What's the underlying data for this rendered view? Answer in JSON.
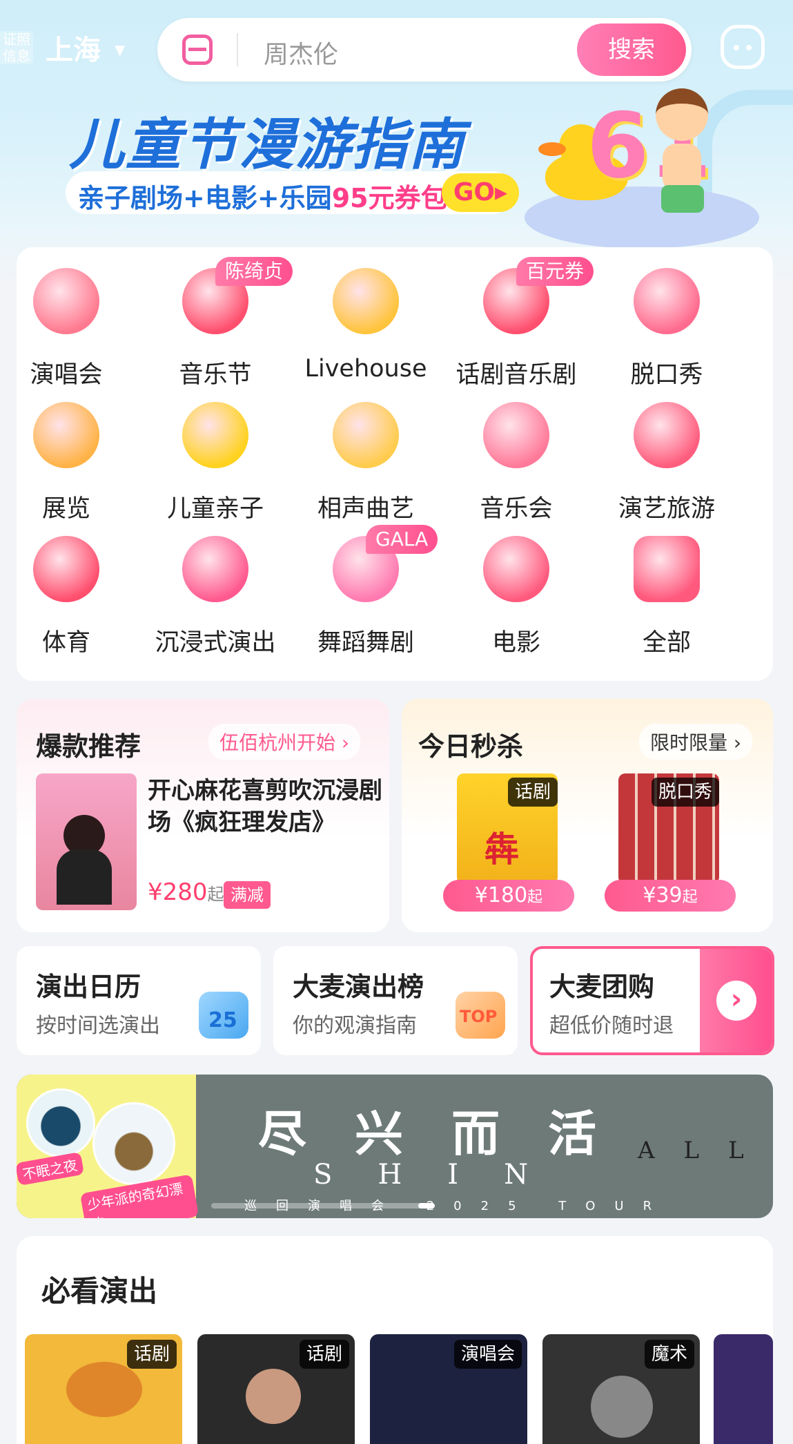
{
  "header": {
    "license_line1": "证照",
    "license_line2": "信息",
    "city": "上海",
    "search_placeholder": "周杰伦",
    "search_button": "搜索"
  },
  "banner": {
    "title": "儿童节漫游指南",
    "subtitle_prefix": "亲子剧场+电影+乐园",
    "subtitle_highlight": "95元券包",
    "go": "GO",
    "badge_number": "61"
  },
  "categories": [
    {
      "label": "演唱会",
      "icon": "microphone-icon",
      "color": "#ff7a90"
    },
    {
      "label": "音乐节",
      "icon": "music-note-icon",
      "color": "#ff4f6e",
      "badge": "陈绮贞"
    },
    {
      "label": "Livehouse",
      "icon": "guitar-icon",
      "color": "#ffc43d"
    },
    {
      "label": "话剧音乐剧",
      "icon": "theater-icon",
      "color": "#ff4f6e",
      "badge": "百元券"
    },
    {
      "label": "脱口秀",
      "icon": "lips-icon",
      "color": "#ff6b8e"
    },
    {
      "label": "展览",
      "icon": "picture-frame-icon",
      "color": "#ffb347"
    },
    {
      "label": "儿童亲子",
      "icon": "duck-icon",
      "color": "#ffd21f"
    },
    {
      "label": "相声曲艺",
      "icon": "fan-icon",
      "color": "#ffcc4d"
    },
    {
      "label": "音乐会",
      "icon": "piano-icon",
      "color": "#ff7a9a"
    },
    {
      "label": "演艺旅游",
      "icon": "palm-tree-icon",
      "color": "#ff5d7e"
    },
    {
      "label": "体育",
      "icon": "football-icon",
      "color": "#ff4f6e"
    },
    {
      "label": "沉浸式演出",
      "icon": "vr-headset-icon",
      "color": "#ff5a8f"
    },
    {
      "label": "舞蹈舞剧",
      "icon": "dancer-icon",
      "color": "#ff7ab0",
      "badge": "GALA"
    },
    {
      "label": "电影",
      "icon": "clapperboard-icon",
      "color": "#ff5a7e"
    },
    {
      "label": "全部",
      "icon": "grid-icon",
      "color": "#ff5a7e"
    }
  ],
  "hot": {
    "title": "爆款推荐",
    "more": "伍佰杭州开始",
    "name": "开心麻花喜剪吹沉浸剧场《疯狂理发店》",
    "price": "¥280",
    "price_suffix": "起",
    "discount": "满减"
  },
  "flash": {
    "title": "今日秒杀",
    "more": "限时限量",
    "items": [
      {
        "tag": "话剧",
        "price": "¥180",
        "suffix": "起"
      },
      {
        "tag": "脱口秀",
        "price": "¥39",
        "suffix": "起"
      }
    ]
  },
  "shortcuts": [
    {
      "title": "演出日历",
      "subtitle": "按时间选演出",
      "icon": "calendar-icon",
      "icon_text": "25"
    },
    {
      "title": "大麦演出榜",
      "subtitle": "你的观演指南",
      "icon": "top-badge-icon",
      "icon_text": "TOP"
    },
    {
      "title": "大麦团购",
      "subtitle": "超低价随时退",
      "icon": "arrow-right-icon"
    }
  ],
  "promo": {
    "left_tag1": "不眠之夜",
    "left_tag2": "少年派的奇幻漂流",
    "title": "尽兴而活",
    "english": "SHIN",
    "tour": "巡回演唱会 2025 TOUR",
    "right": "ALL"
  },
  "must_see": {
    "title": "必看演出",
    "shows": [
      {
        "tag": "话剧",
        "color": "#f2b93a"
      },
      {
        "tag": "话剧",
        "color": "#2a2a2a"
      },
      {
        "tag": "演唱会",
        "color": "#1d2240"
      },
      {
        "tag": "魔术",
        "color": "#333"
      },
      {
        "tag": "",
        "color": "#3a2a6a"
      }
    ]
  }
}
